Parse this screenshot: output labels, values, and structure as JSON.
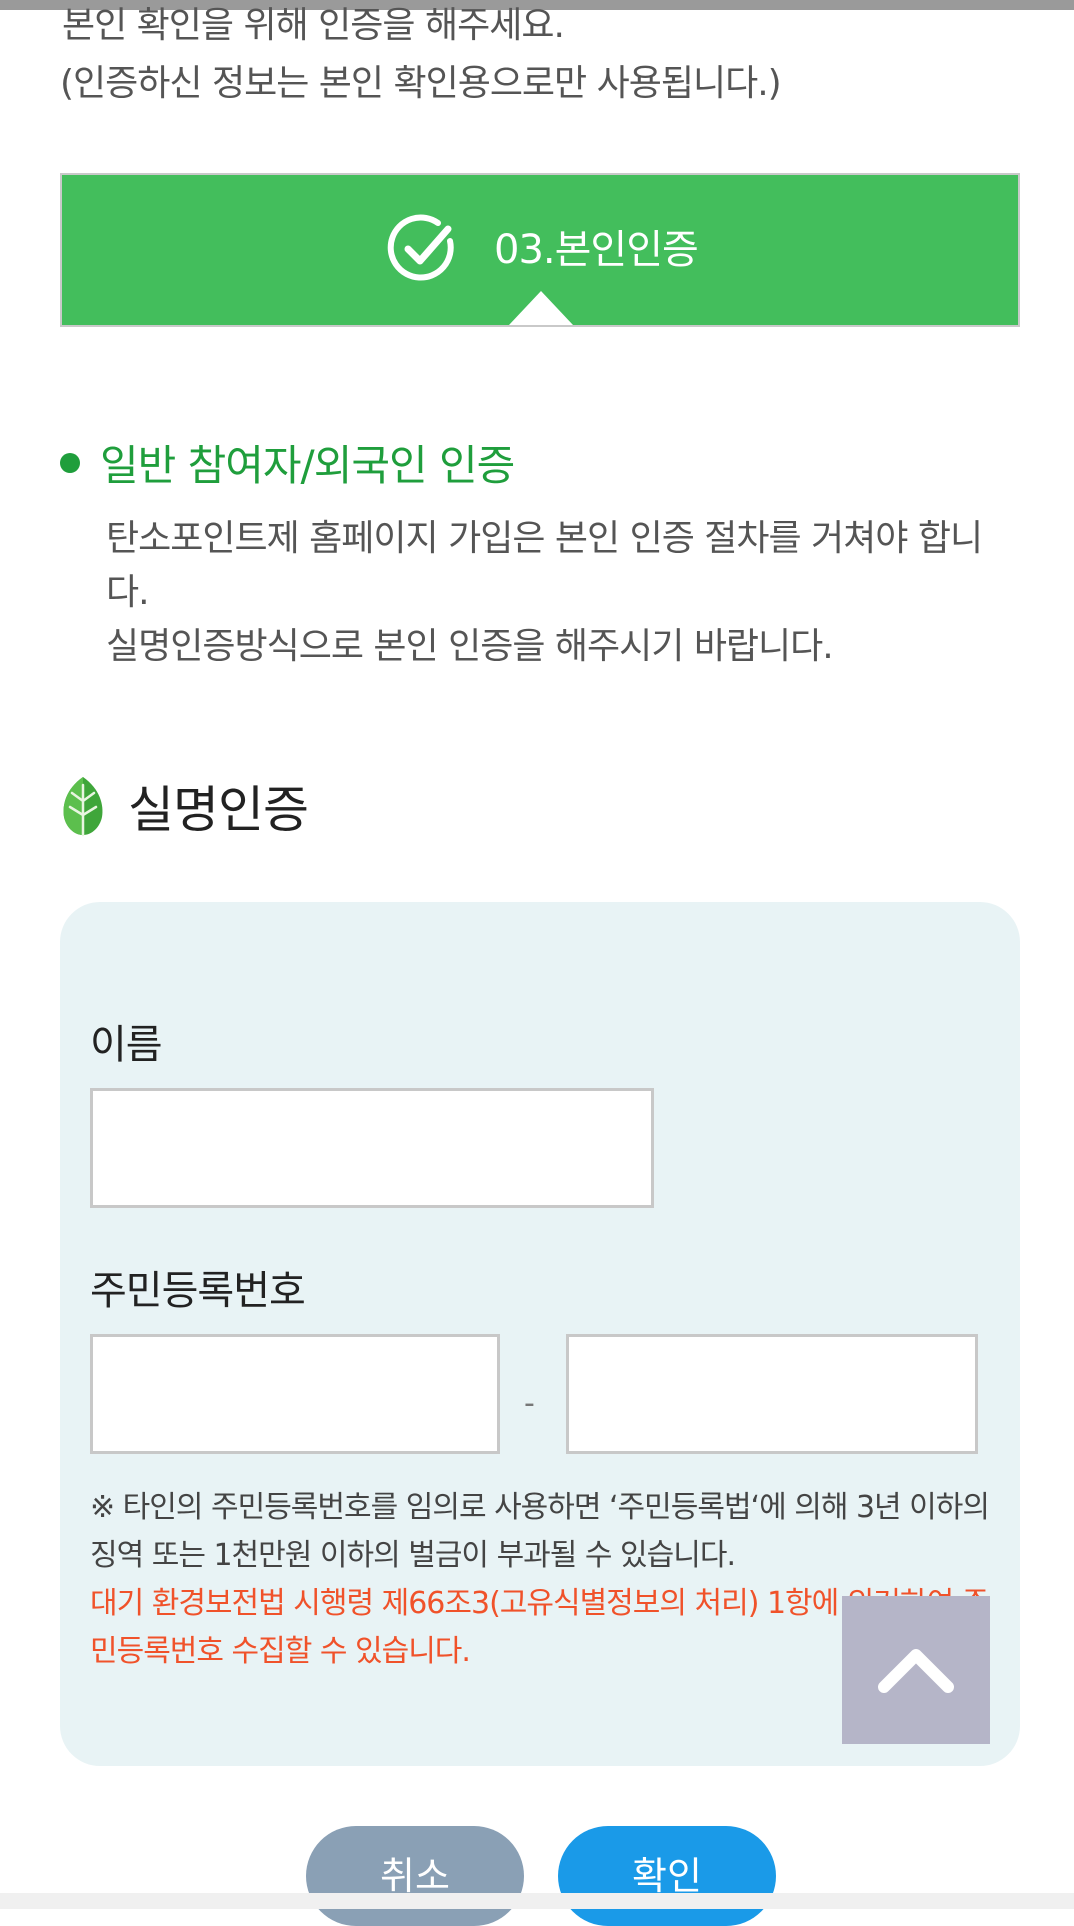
{
  "intro": {
    "line1": "본인 확인을 위해 인증을 해주세요.",
    "line2": "(인증하신 정보는 본인 확인용으로만 사용됩니다.)"
  },
  "step": {
    "label": "03.본인인증",
    "icon": "check-circle-icon"
  },
  "section": {
    "title": "일반 참여자/외국인 인증",
    "desc_line1": "탄소포인트제 홈페이지 가입은 본인 인증 절차를 거쳐야 합니다.",
    "desc_line2": "실명인증방식으로 본인 인증을 해주시기 바랍니다."
  },
  "subsection": {
    "title": "실명인증",
    "icon": "leaf-icon"
  },
  "form": {
    "name_label": "이름",
    "name_value": "",
    "rrn_label": "주민등록번호",
    "rrn_front_value": "",
    "rrn_separator": "-",
    "rrn_back_value": "",
    "notice_black": "※ 타인의 주민등록번호를 임의로 사용하면 ‘주민등록법‘에 의해 3년 이하의 징역 또는 1천만원 이하의 벌금이 부과될 수 있습니다.",
    "notice_orange": "대기 환경보전법 시행령 제66조3(고유식별정보의 처리) 1항에 의거하여 주민등록번호 수집할 수 있습니다."
  },
  "buttons": {
    "cancel": "취소",
    "confirm": "확인"
  },
  "scroll_top": {
    "icon": "chevron-up-icon"
  },
  "colors": {
    "banner_green": "#43be5c",
    "heading_green": "#1f9e3c",
    "panel_bg": "#e8f3f5",
    "notice_orange": "#f0522a",
    "cancel_btn": "#8aa0b5",
    "confirm_btn": "#1a9ae8"
  }
}
